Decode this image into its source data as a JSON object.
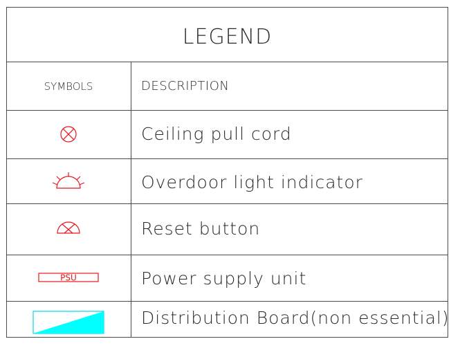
{
  "legend": {
    "title": "LEGEND",
    "header": {
      "symbols": "SYMBOLS",
      "description": "DESCRIPTION"
    },
    "rows": [
      {
        "icon": "ceiling-pull-cord-icon",
        "description": "Ceiling pull cord"
      },
      {
        "icon": "overdoor-light-indicator-icon",
        "description": "Overdoor light indicator"
      },
      {
        "icon": "reset-button-icon",
        "description": "Reset button"
      },
      {
        "icon": "psu-icon",
        "symbol_text": "PSU",
        "description": "Power supply unit"
      },
      {
        "icon": "distribution-board-icon",
        "description": "Distribution Board(non essential)"
      }
    ],
    "colors": {
      "symbol": "#e8141b",
      "distribution_board": "#00ffff",
      "lines": "#4a4a4a",
      "text": "#2a2a2a"
    }
  }
}
